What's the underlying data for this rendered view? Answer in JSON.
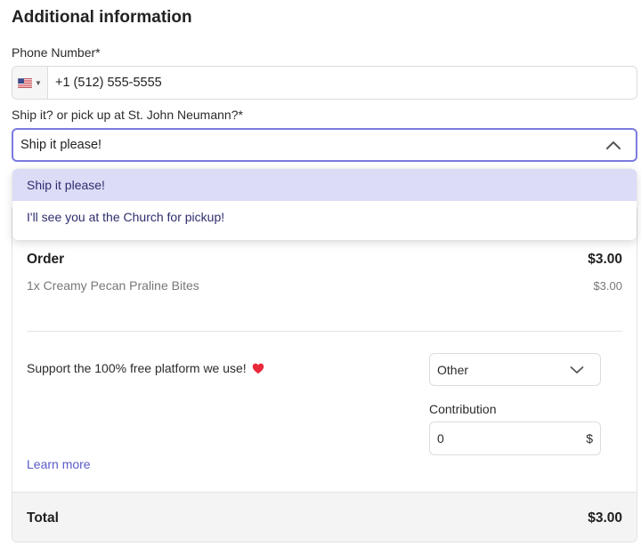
{
  "section": {
    "title": "Additional information"
  },
  "phone": {
    "label": "Phone Number*",
    "country_icon": "us-flag-icon",
    "value": "+1 (512) 555-5555"
  },
  "shipping": {
    "label": "Ship it? or pick up at St. John Neumann?*",
    "selected": "Ship it please!",
    "options": [
      {
        "label": "Ship it please!",
        "selected": true
      },
      {
        "label": "I'll see you at the Church for pickup!",
        "selected": false
      }
    ]
  },
  "order": {
    "title": "Order",
    "total": "$3.00",
    "items": [
      {
        "name": "1x Creamy Pecan Praline Bites",
        "price": "$3.00"
      }
    ]
  },
  "support": {
    "text": "Support the 100% free platform we use!",
    "icon": "heart-icon",
    "tip_option": "Other",
    "contribution_label": "Contribution",
    "contribution_value": "0",
    "currency_symbol": "$",
    "learn_more": "Learn more"
  },
  "total": {
    "label": "Total",
    "value": "$3.00"
  },
  "colors": {
    "accent": "#7b7be0",
    "option_highlight": "#dcdcf7",
    "link": "#5a5acb",
    "heart": "#e8293a"
  }
}
